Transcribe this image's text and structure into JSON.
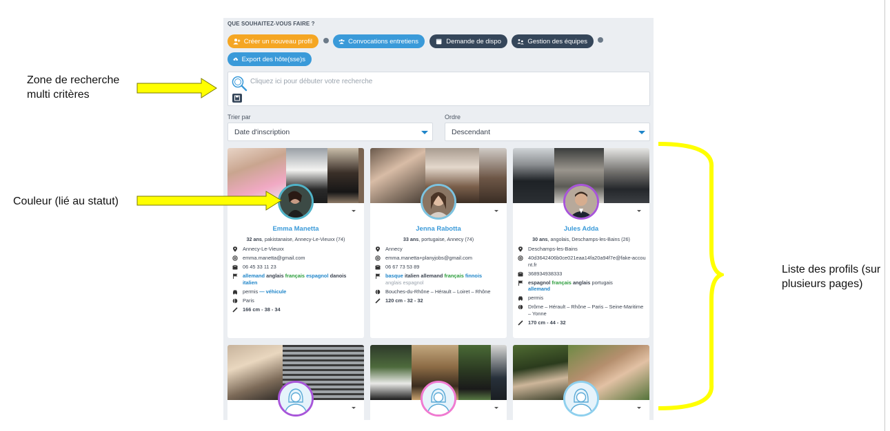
{
  "toolbar": {
    "title": "QUE SOUHAITEZ-VOUS FAIRE ?",
    "buttons": [
      {
        "label": "Créer un nouveau profil",
        "icon": "add-user-icon",
        "color": "#f5a623"
      },
      {
        "label": "Convocations entretiens",
        "icon": "group-icon",
        "color": "#3a9ad9"
      },
      {
        "label": "Demande de dispo",
        "icon": "calendar-icon",
        "color": "#35465a"
      },
      {
        "label": "Gestion des équipes",
        "icon": "team-icon",
        "color": "#35465a"
      },
      {
        "label": "Export des hôte(sse)s",
        "icon": "cloud-download-icon",
        "color": "#3a9ad9"
      }
    ]
  },
  "search": {
    "placeholder": "Cliquez ici pour débuter votre recherche"
  },
  "sort": {
    "sort_label": "Trier par",
    "sort_value": "Date d'inscription",
    "order_label": "Ordre",
    "order_value": "Descendant"
  },
  "profiles": [
    {
      "name": "Emma Manetta",
      "age": "32 ans",
      "origin": ", pakistanaise, Annecy-Le-Vieuxx (74)",
      "city": "Annecy-Le-Vieuxx",
      "email": "emma.manetta@gmail.com",
      "phone": "06 45 33 11 23",
      "permis": "permis",
      "vehicule": " — véhicule",
      "zones": "Paris",
      "mensurations": "166 cm - 38 - 34",
      "ring_color": "#4fb3c8"
    },
    {
      "name": "Jenna Rabotta",
      "age": "33 ans",
      "origin": ", portugaise, Annecy (74)",
      "city": "Annecy",
      "email": "emma.manetta+planyjobs@gmail.com",
      "phone": "06 67 73 53 89",
      "zones": "Bouches-du-Rhône – Hérault – Loiret – Rhône",
      "mensurations": "120 cm - 32 - 32",
      "ring_color": "#7cc3e0"
    },
    {
      "name": "Jules Adda",
      "age": "30 ans",
      "origin": ", angolais, Deschamps-les-Bains (26)",
      "city": "Deschamps-les-Bains",
      "email": "40d3642406b0ce021eaa14fa20a94f7e@fake-account.fr",
      "phone": "368934938333",
      "permis": "permis",
      "zones": "Drôme – Hérault – Rhône – Paris – Seine-Maritime – Yonne",
      "mensurations": "170 cm - 44 - 32",
      "ring_color": "#a855d9"
    },
    {
      "ring_color": "#a855d9"
    },
    {
      "ring_color": "#f07ad0"
    },
    {
      "ring_color": "#8fd0ee"
    }
  ],
  "langs": {
    "p1": {
      "l1": "allemand",
      "l2": "anglais",
      "l3": "français",
      "l4": "espagnol",
      "l5": "danois",
      "l6": "italien"
    },
    "p2": {
      "l1": "basque",
      "l2": "italien",
      "l3": "allemand",
      "l4": "français",
      "l5": "finnois",
      "l6": "anglais espagnol"
    },
    "p3": {
      "l1": "espagnol",
      "l2": "français",
      "l3": "anglais",
      "l4": "portugais",
      "l5": "allemand"
    }
  },
  "annotations": {
    "search_zone": "Zone de recherche multi critères",
    "color": "Couleur (lié au statut)",
    "list": "Liste des profils (sur plusieurs pages)",
    "arrow_color": "#ffff00",
    "brace_color": "#ffff00"
  }
}
